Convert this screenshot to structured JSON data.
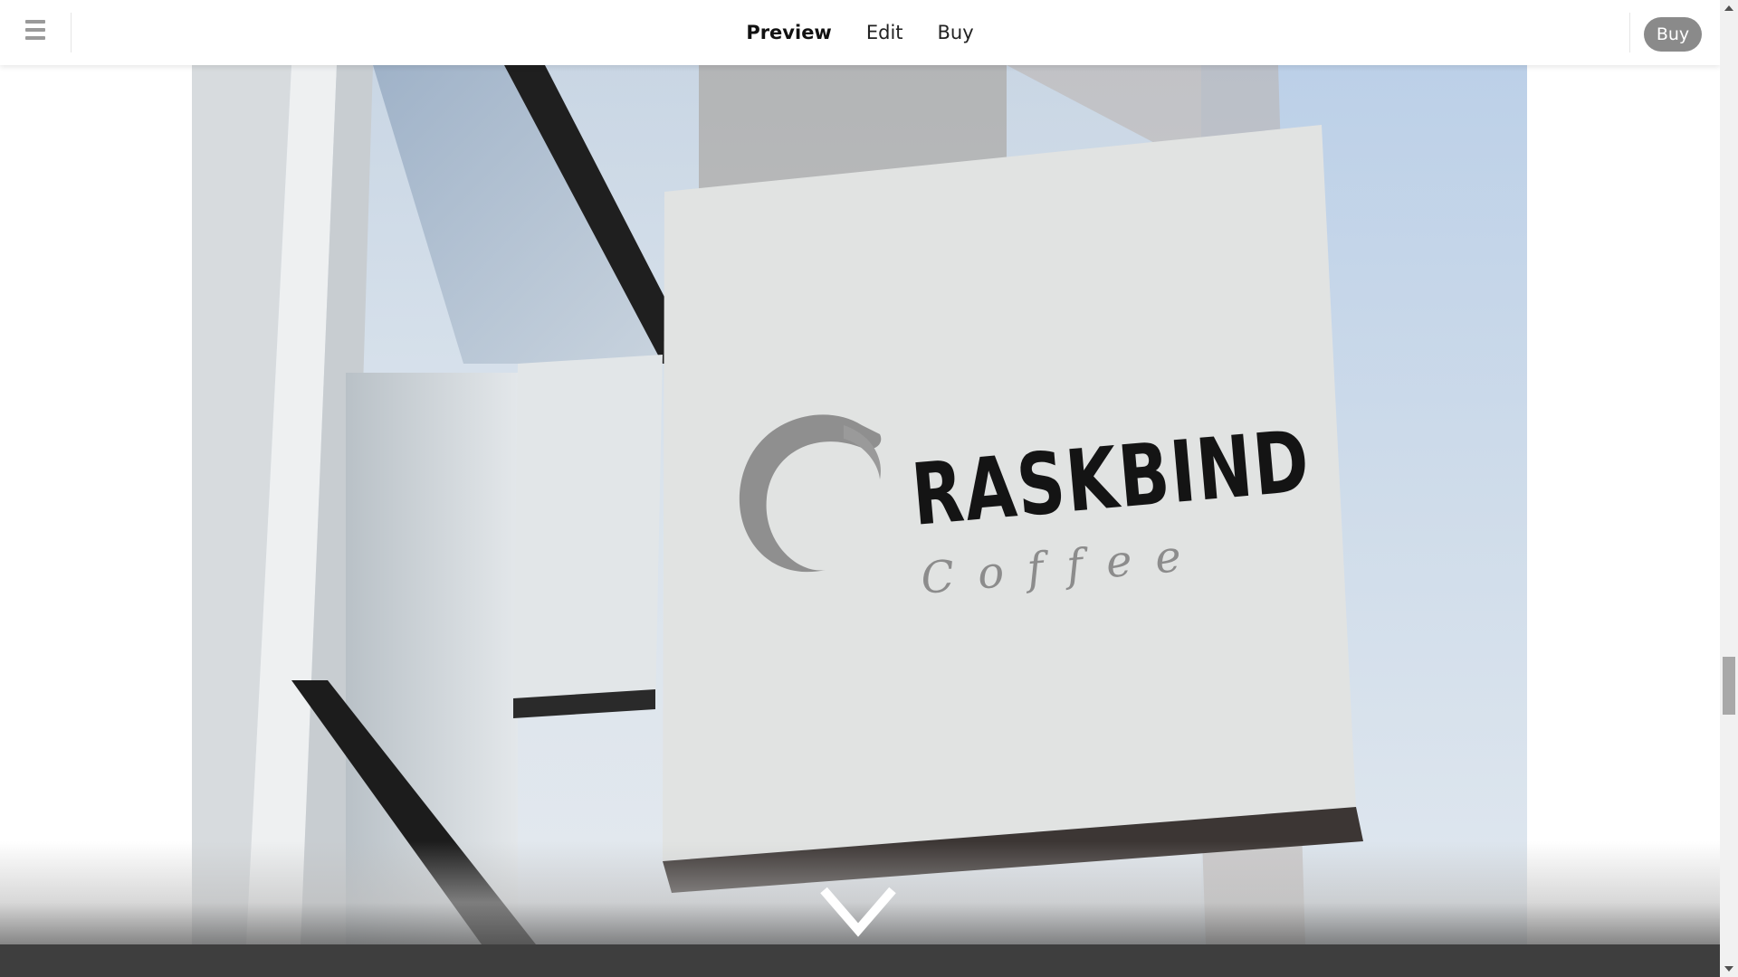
{
  "nav": {
    "tabs": [
      {
        "label": "Preview"
      },
      {
        "label": "Edit"
      },
      {
        "label": "Buy"
      }
    ],
    "buy_button": "Buy"
  },
  "hero": {
    "brand_name": "RASKBIND",
    "brand_sub": "Coffee"
  },
  "icons": {
    "menu": "hamburger-menu-icon",
    "scroll": "chevron-down-icon"
  },
  "colors": {
    "buy_pill": "#8a8a8a",
    "nav_text": "#222222",
    "logo_dark": "#141414",
    "logo_gray": "#8c8c8c"
  }
}
